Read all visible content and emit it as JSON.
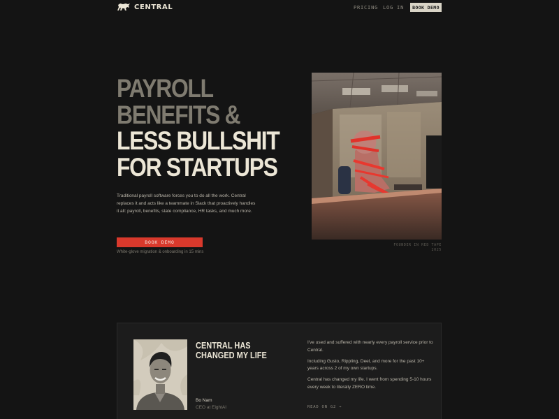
{
  "nav": {
    "logo_icon": "horse-icon",
    "brand": "CENTRAL",
    "pricing": "PRICING",
    "login": "LOG IN",
    "cta": "BOOK DEMO"
  },
  "hero": {
    "headline": [
      "PAYROLL",
      "BENEFITS &",
      "LESS BULLSHIT",
      "FOR STARTUPS"
    ],
    "description": "Traditional payroll software forces you to do all the work. Central replaces it and acts like a teammate in Slack that proactively handles it all: payroll, benefits, state compliance, HR tasks, and much more.",
    "cta": "BOOK DEMO",
    "note": "White-glove migration & onboarding in 15 mins",
    "caption_line1": "FOUNDER IN RED TAPE",
    "caption_line2": "2025"
  },
  "testimonial": {
    "title_line1": "CENTRAL HAS",
    "title_line2": "CHANGED MY LIFE",
    "name": "Bo Nam",
    "role": "CEO at EightAI",
    "quote": [
      "I've used and suffered with nearly every payroll service prior to Central.",
      "Including Gusto, Rippling, Deel, and more for the past 10+ years across 2 of my own startups.",
      "Central has changed my life. I went from spending 5-10 hours every week to literally ZERO time."
    ],
    "link": "READ ON G2 →"
  },
  "colors": {
    "background": "#141414",
    "accent_red": "#d9392c",
    "text_light": "#ece6d6",
    "text_dim": "#7f7b70"
  }
}
